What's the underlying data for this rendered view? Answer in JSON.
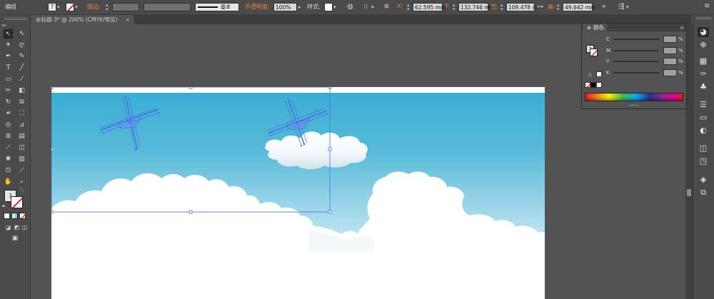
{
  "control_bar": {
    "selection_label": "编组",
    "stroke_label": "描边:",
    "stroke_style": "基本",
    "opacity_label": "不透明度:",
    "opacity_value": "100%",
    "style_label": "样式:",
    "x_label": "X:",
    "x_value": "62.595 mm",
    "y_label": "Y:",
    "y_value": "132.746 mm",
    "w_label": "宽:",
    "w_value": "109.478 m",
    "h_label": "高:",
    "h_value": "49.642 mm",
    "accent_color": "#e5843a"
  },
  "document_tab": {
    "title": "未标题-3* @ 200% (CMYK/预览)",
    "close": "×"
  },
  "color_panel": {
    "title": "颜色",
    "channels": [
      {
        "name": "C",
        "unit": "%"
      },
      {
        "name": "M",
        "unit": "%"
      },
      {
        "name": "Y",
        "unit": "%"
      },
      {
        "name": "K",
        "unit": "%"
      }
    ]
  },
  "canvas": {
    "sky_top_color": "#3aaed2",
    "selection_color": "#4a6ee8"
  },
  "icons": {
    "toolbox": [
      "selection-tool",
      "direct-selection-tool",
      "magic-wand-tool",
      "lasso-tool",
      "pen-tool",
      "curvature-tool",
      "type-tool",
      "line-segment-tool",
      "rectangle-tool",
      "paintbrush-tool",
      "pencil-tool",
      "eraser-tool",
      "rotate-tool",
      "scale-tool",
      "warp-tool",
      "free-transform-tool",
      "shape-builder-tool",
      "perspective-grid-tool",
      "mesh-tool",
      "gradient-tool",
      "eyedropper-tool",
      "blend-tool",
      "symbol-sprayer-tool",
      "column-graph-tool",
      "artboard-tool",
      "slice-tool",
      "hand-tool",
      "zoom-tool"
    ],
    "dock": [
      "color-guide-icon",
      "swatches-icon",
      "symbols-icon",
      "brushes-icon",
      "graphic-styles-icon",
      "stroke-icon",
      "gradient-icon",
      "transparency-icon",
      "appearance-icon",
      "align-icon",
      "layers-icon",
      "artboards-icon"
    ]
  }
}
